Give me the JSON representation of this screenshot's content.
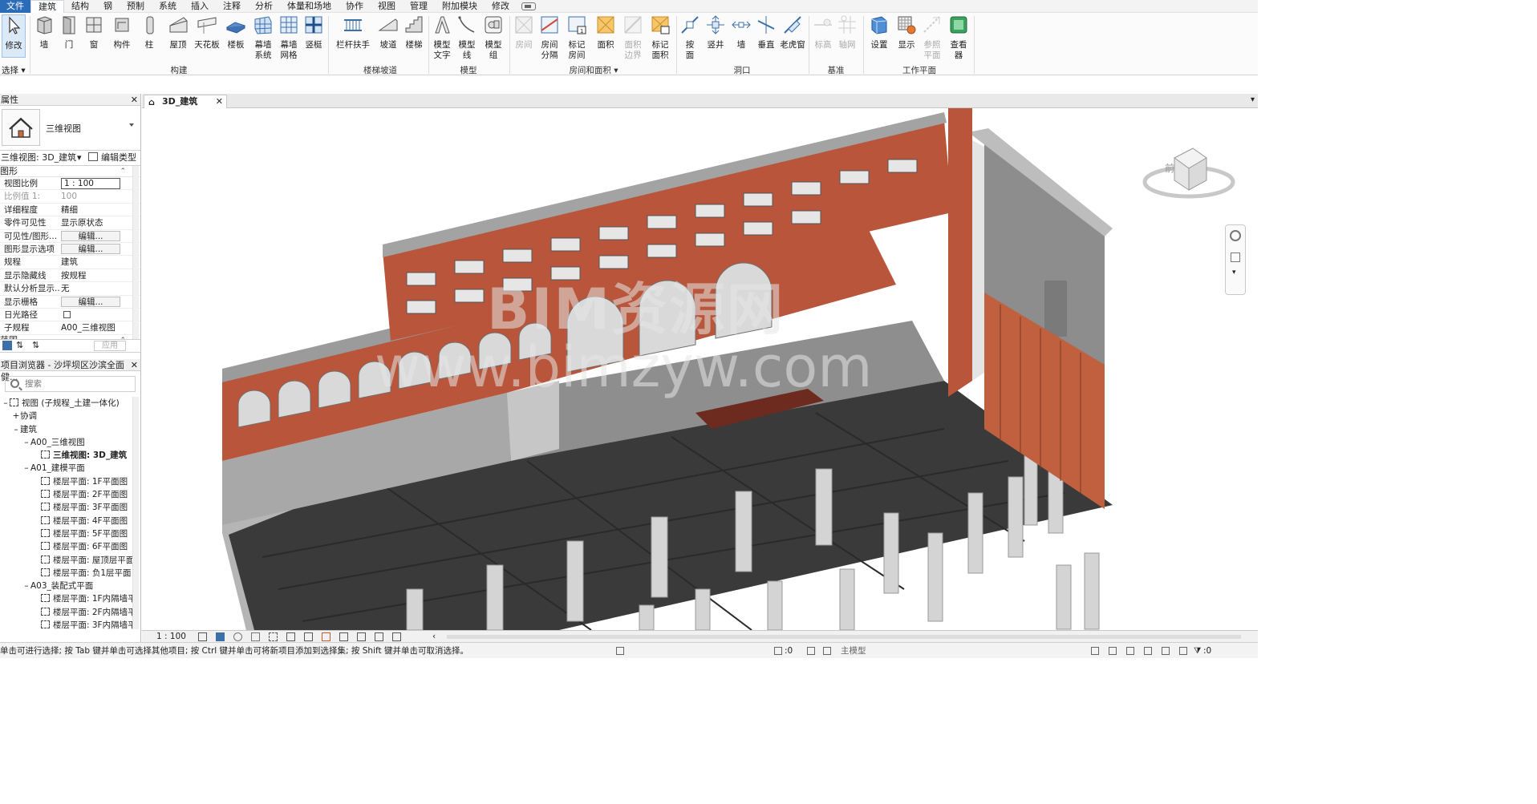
{
  "menu": {
    "items": [
      "文件",
      "建筑",
      "结构",
      "钢",
      "预制",
      "系统",
      "插入",
      "注释",
      "分析",
      "体量和场地",
      "协作",
      "视图",
      "管理",
      "附加模块",
      "修改"
    ],
    "active_index": 1
  },
  "ribbon": {
    "select_label": "选择",
    "modify": "修改",
    "build": {
      "wall": "墙",
      "door": "门",
      "window": "窗",
      "component": "构件",
      "column": "柱",
      "roof": "屋顶",
      "ceiling": "天花板",
      "floor": "楼板",
      "curtain_system": [
        "幕墙",
        "系统"
      ],
      "curtain_grid": [
        "幕墙",
        "网格"
      ],
      "mullion": "竖梃",
      "panel": "构建"
    },
    "circulation": {
      "railing": "栏杆扶手",
      "ramp": "坡道",
      "stair": "楼梯",
      "panel": "楼梯坡道"
    },
    "model": {
      "model_text": [
        "模型",
        "文字"
      ],
      "model_line": [
        "模型",
        "线"
      ],
      "model_group": [
        "模型",
        "组"
      ],
      "panel": "模型"
    },
    "room_area": {
      "room": "房间",
      "room_separator": [
        "房间",
        "分隔"
      ],
      "tag_room": [
        "标记",
        "房间"
      ],
      "area": "面积",
      "area_boundary": [
        "面积",
        "边界"
      ],
      "tag_area": [
        "标记",
        "面积"
      ],
      "panel": "房间和面积"
    },
    "opening": {
      "by_face": [
        "按",
        "面"
      ],
      "shaft": "竖井",
      "wall": "墙",
      "vertical": "垂直",
      "dormer": "老虎窗",
      "panel": "洞口"
    },
    "datum": {
      "level": "标高",
      "grid": "轴网",
      "panel": "基准"
    },
    "work_plane": {
      "set": "设置",
      "show": "显示",
      "ref_plane": [
        "参照",
        "平面"
      ],
      "viewer": "查看器",
      "panel": "工作平面"
    }
  },
  "properties": {
    "title": "属性",
    "type_name": "三维视图",
    "selector": "三维视图: 3D_建筑",
    "edit_type": "编辑类型",
    "group_graphics": "图形",
    "group_range": "范围",
    "rows": [
      {
        "k": "视图比例",
        "v": "1 : 100",
        "kind": "box"
      },
      {
        "k": "比例值 1:",
        "v": "100",
        "kind": "dim"
      },
      {
        "k": "详细程度",
        "v": "精细",
        "kind": "text"
      },
      {
        "k": "零件可见性",
        "v": "显示原状态",
        "kind": "text"
      },
      {
        "k": "可见性/图形...",
        "v": "编辑...",
        "kind": "btn"
      },
      {
        "k": "图形显示选项",
        "v": "编辑...",
        "kind": "btn"
      },
      {
        "k": "规程",
        "v": "建筑",
        "kind": "text"
      },
      {
        "k": "显示隐藏线",
        "v": "按规程",
        "kind": "text"
      },
      {
        "k": "默认分析显示...",
        "v": "无",
        "kind": "text"
      },
      {
        "k": "显示栅格",
        "v": "编辑...",
        "kind": "btn"
      },
      {
        "k": "日光路径",
        "v": "",
        "kind": "check"
      },
      {
        "k": "子规程",
        "v": "A00_三维视图",
        "kind": "text"
      }
    ],
    "apply": "应用"
  },
  "browser": {
    "title": "项目浏览器 - 沙坪坝区沙滨全面健...",
    "search_placeholder": "搜索",
    "tree": [
      {
        "indent": 0,
        "tw": "–",
        "icon": true,
        "label": "视图 (子规程_土建一体化)"
      },
      {
        "indent": 1,
        "tw": "+",
        "icon": false,
        "label": "协调"
      },
      {
        "indent": 1,
        "tw": "–",
        "icon": false,
        "label": "建筑"
      },
      {
        "indent": 2,
        "tw": "–",
        "icon": false,
        "label": "A00_三维视图"
      },
      {
        "indent": 3,
        "tw": "",
        "icon": true,
        "label": "三维视图: 3D_建筑",
        "bold": true
      },
      {
        "indent": 2,
        "tw": "–",
        "icon": false,
        "label": "A01_建模平面"
      },
      {
        "indent": 3,
        "tw": "",
        "icon": true,
        "label": "楼层平面: 1F平面图"
      },
      {
        "indent": 3,
        "tw": "",
        "icon": true,
        "label": "楼层平面: 2F平面图"
      },
      {
        "indent": 3,
        "tw": "",
        "icon": true,
        "label": "楼层平面: 3F平面图"
      },
      {
        "indent": 3,
        "tw": "",
        "icon": true,
        "label": "楼层平面: 4F平面图"
      },
      {
        "indent": 3,
        "tw": "",
        "icon": true,
        "label": "楼层平面: 5F平面图"
      },
      {
        "indent": 3,
        "tw": "",
        "icon": true,
        "label": "楼层平面: 6F平面图"
      },
      {
        "indent": 3,
        "tw": "",
        "icon": true,
        "label": "楼层平面: 屋顶层平面"
      },
      {
        "indent": 3,
        "tw": "",
        "icon": true,
        "label": "楼层平面: 负1层平面"
      },
      {
        "indent": 2,
        "tw": "–",
        "icon": false,
        "label": "A03_装配式平面"
      },
      {
        "indent": 3,
        "tw": "",
        "icon": true,
        "label": "楼层平面: 1F内隔墙平"
      },
      {
        "indent": 3,
        "tw": "",
        "icon": true,
        "label": "楼层平面: 2F内隔墙平"
      },
      {
        "indent": 3,
        "tw": "",
        "icon": true,
        "label": "楼层平面: 3F内隔墙平"
      }
    ]
  },
  "view": {
    "tab_title": "3D_建筑",
    "watermark_line1": "BIM资源网",
    "watermark_line2": "www.bimzyw.com",
    "viewcube_face": "前",
    "scale": "1 : 100"
  },
  "status": {
    "message": "单击可进行选择; 按 Tab 键并单击可选择其他项目; 按 Ctrl 键并单击可将新项目添加到选择集; 按 Shift 键并单击可取消选择。",
    "worksets": ":0",
    "main_model": "主模型",
    "filter_count": ":0"
  },
  "colors": {
    "brick": "#b8553a",
    "concrete": "#9a9a9a",
    "slab": "#3a3a3a",
    "accent": "#2b6cb8"
  }
}
